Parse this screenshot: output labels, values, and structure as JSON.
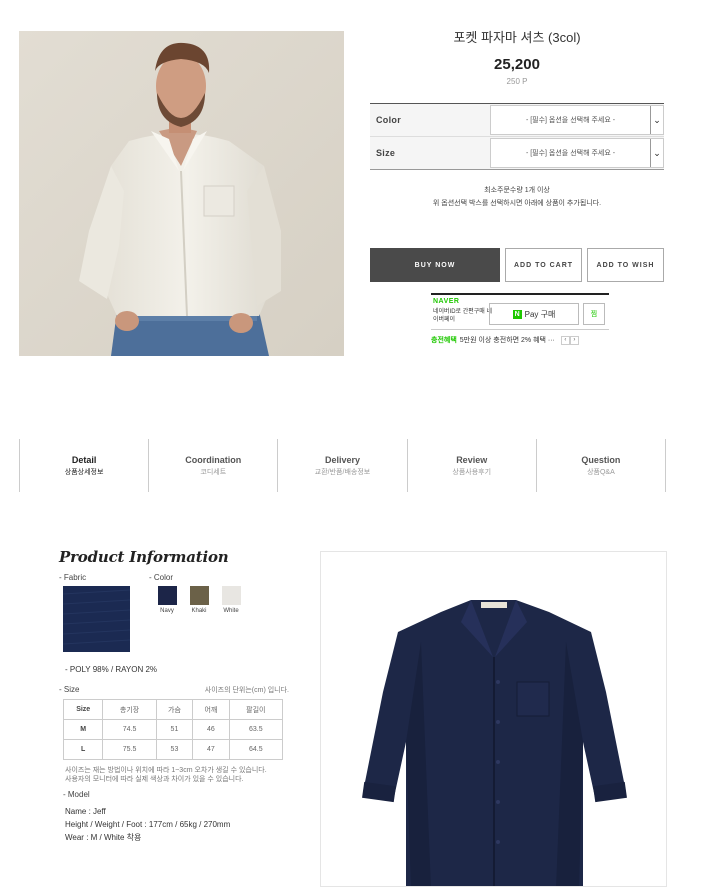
{
  "product": {
    "title": "포켓 파자마 셔츠 (3col)",
    "price": "25,200",
    "points": "250 P"
  },
  "options": [
    {
      "label": "Color",
      "value": "- [필수] 옵션을 선택해 주세요 -"
    },
    {
      "label": "Size",
      "value": "- [필수] 옵션을 선택해 주세요 -"
    }
  ],
  "notice": {
    "line1": "최소주문수량 1개 이상",
    "line2": "위 옵션선택 박스를 선택하시면 아래에 상품이 추가됩니다."
  },
  "buttons": {
    "buy": "BUY NOW",
    "cart": "ADD TO CART",
    "wish": "ADD TO WISH"
  },
  "npay": {
    "logo": "NAVER",
    "desc": "네이버ID로 간편구매 네이버페이",
    "button": "Pay 구매",
    "button_mark": "N",
    "zzim": "찜",
    "benefit_label": "충전혜택",
    "benefit_text": "5만원 이상 충전하면 2% 혜택 ···",
    "prev": "‹",
    "next": "›"
  },
  "tabs": [
    {
      "en": "Detail",
      "ko": "상품상세정보"
    },
    {
      "en": "Coordination",
      "ko": "코디세트"
    },
    {
      "en": "Delivery",
      "ko": "교환/반품/배송정보"
    },
    {
      "en": "Review",
      "ko": "상품사용후기"
    },
    {
      "en": "Question",
      "ko": "상품Q&A"
    }
  ],
  "info": {
    "heading": "Product Information",
    "fabric_label": "- Fabric",
    "color_label": "- Color",
    "colors": [
      {
        "name": "Navy",
        "hex": "#1c2548"
      },
      {
        "name": "Khaki",
        "hex": "#6b6148"
      },
      {
        "name": "White",
        "hex": "#e8e6e2"
      }
    ],
    "fabric_hex": "#1b2a52",
    "composition": "- POLY 98% / RAYON 2%",
    "size_label": "- Size",
    "size_unit": "사이즈의 단위는(cm) 입니다.",
    "size_table": {
      "headers": [
        "Size",
        "총기장",
        "가슴",
        "어깨",
        "팔길이"
      ],
      "rows": [
        [
          "M",
          "74.5",
          "51",
          "46",
          "63.5"
        ],
        [
          "L",
          "75.5",
          "53",
          "47",
          "64.5"
        ]
      ]
    },
    "size_note1": "사이즈는 재는 방법이나 위치에 따라 1~3cm 오차가 생길 수 있습니다.",
    "size_note2": "사용자의 모니터에 따라 실제 색상과 차이가 있을 수 있습니다.",
    "model_label": "- Model",
    "model_name": "Name : Jeff",
    "model_body": "Height / Weight / Foot : 177cm / 65kg / 270mm",
    "model_wear": "Wear : M / White 착용"
  }
}
